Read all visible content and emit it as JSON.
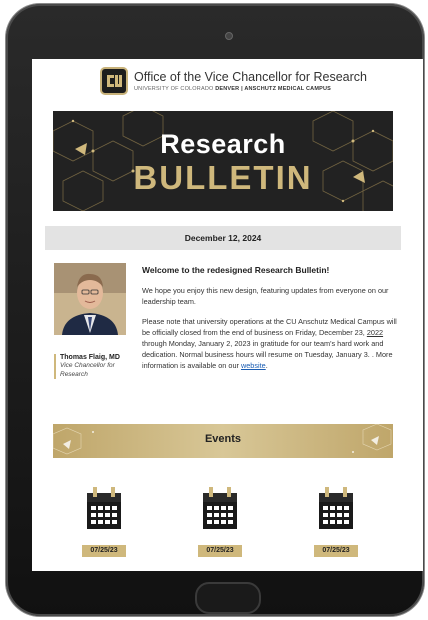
{
  "header": {
    "office_title": "Office of the Vice Chancellor for Research",
    "sub_prefix": "UNIVERSITY OF COLORADO ",
    "sub_bold": "DENVER | ANSCHUTZ MEDICAL CAMPUS",
    "logo_icon": "cu-logo-icon"
  },
  "banner": {
    "line1": "Research",
    "line2": "BULLETIN"
  },
  "date": "December 12, 2024",
  "profile": {
    "name": "Thomas Flaig, MD",
    "role": "Vice Chancellor for Research"
  },
  "article": {
    "heading": "Welcome to the redesigned Research Bulletin!",
    "para1": "We hope you enjoy this new design, featuring updates from everyone on our leadership team.",
    "para2_a": "Please note that university operations at the CU Anschutz Medical Campus will be officially closed from the end of business on Friday, December 23, ",
    "para2_year": "2022",
    "para2_b": " through Monday, January 2, 2023 in gratitude for our team's hard work and dedication. Normal business hours will resume on Tuesday, January 3. . More information is available on our ",
    "link": "website",
    "para2_end": "."
  },
  "events": {
    "title": "Events",
    "items": [
      {
        "date": "07/25/23",
        "icon": "calendar-icon"
      },
      {
        "date": "07/25/23",
        "icon": "calendar-icon"
      },
      {
        "date": "07/25/23",
        "icon": "calendar-icon"
      }
    ]
  },
  "colors": {
    "gold": "#cfb87c",
    "banner_bg": "#222222",
    "link": "#1a5db3"
  }
}
